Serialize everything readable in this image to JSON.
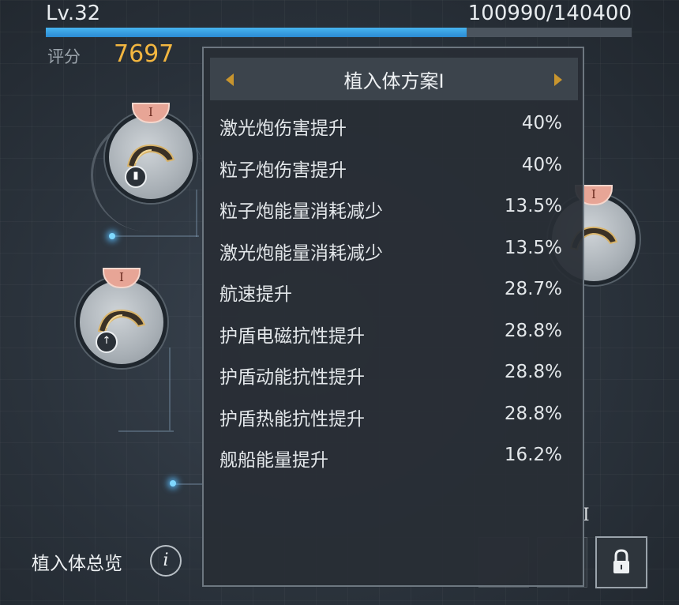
{
  "player": {
    "level": "Lv.32",
    "xp_text": "100990/140400",
    "xp_progress": 0.719,
    "score_label": "评分",
    "score_value": "7697"
  },
  "slots": [
    {
      "badge": "I",
      "sub_icon": "battery-icon"
    },
    {
      "badge": "I",
      "sub_icon": "speed-arrow-icon"
    },
    {
      "badge": "I",
      "sub_icon": "implant-icon"
    }
  ],
  "bottom": {
    "overview_label": "植入体总览",
    "info_icon": "i",
    "right_roman": "I"
  },
  "panel": {
    "title": "植入体方案I",
    "stats": [
      {
        "name": "激光炮伤害提升",
        "value": "40%"
      },
      {
        "name": "粒子炮伤害提升",
        "value": "40%"
      },
      {
        "name": "粒子炮能量消耗减少",
        "value": "13.5%"
      },
      {
        "name": "激光炮能量消耗减少",
        "value": "13.5%"
      },
      {
        "name": "航速提升",
        "value": "28.7%"
      },
      {
        "name": "护盾电磁抗性提升",
        "value": "28.8%"
      },
      {
        "name": "护盾动能抗性提升",
        "value": "28.8%"
      },
      {
        "name": "护盾热能抗性提升",
        "value": "28.8%"
      },
      {
        "name": "舰船能量提升",
        "value": "16.2%"
      }
    ]
  },
  "colors": {
    "accent_gold": "#f2b640",
    "xp_blue": "#47b4f0",
    "badge_salmon": "#e7a596"
  }
}
